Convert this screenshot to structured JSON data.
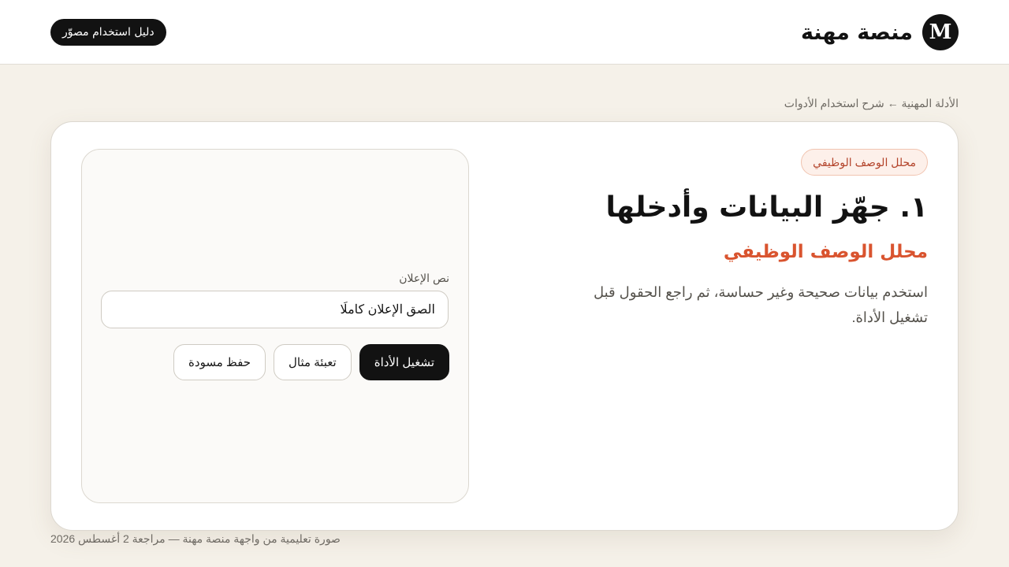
{
  "header": {
    "brand_logo_letter": "M",
    "brand_name": "منصة مهنة",
    "guide_button_label": "دليل استخدام مصوّر"
  },
  "breadcrumb": "الأدلة المهنية ← شرح استخدام الأدوات",
  "card": {
    "tag": "محلل الوصف الوظيفي",
    "heading": "١. جهّز البيانات وأدخلها",
    "subheading": "محلل الوصف الوظيفي",
    "description": "استخدم بيانات صحيحة وغير حساسة، ثم راجع الحقول قبل تشغيل الأداة."
  },
  "form": {
    "field_label": "نص الإعلان",
    "field_value": "الصق الإعلان كاملًا",
    "run_button": "تشغيل الأداة",
    "sample_button": "تعبئة مثال",
    "draft_button": "حفظ مسودة"
  },
  "footer": "صورة تعليمية من واجهة منصة مهنة — مراجعة 2 أغسطس 2026",
  "colors": {
    "accent": "#d9542f",
    "dark": "#121212",
    "page_bg": "#f5f1e9"
  }
}
